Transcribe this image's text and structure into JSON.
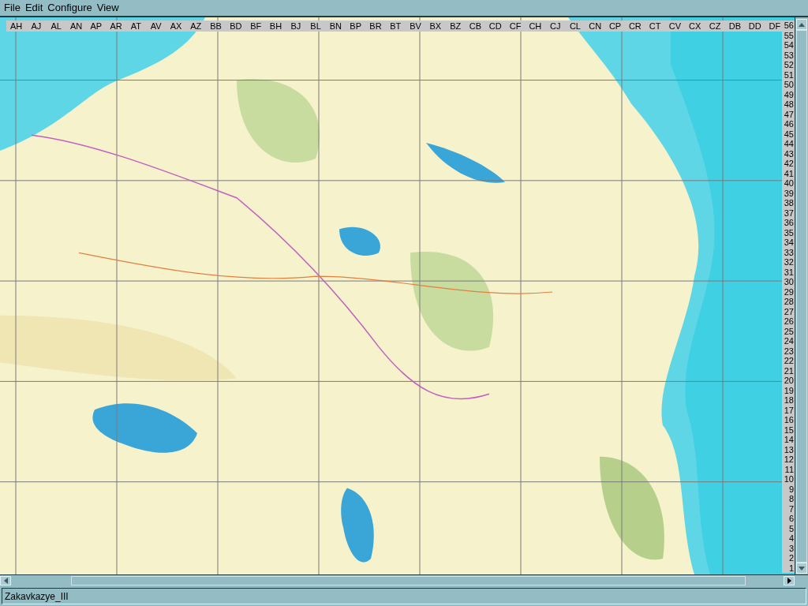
{
  "menu": [
    "File",
    "Edit",
    "Configure",
    "View"
  ],
  "grid_columns": [
    "AH",
    "AJ",
    "AL",
    "AN",
    "AP",
    "AR",
    "AT",
    "AV",
    "AX",
    "AZ",
    "BB",
    "BD",
    "BF",
    "BH",
    "BJ",
    "BL",
    "BN",
    "BP",
    "BR",
    "BT",
    "BV",
    "BX",
    "BZ",
    "CB",
    "CD",
    "CF",
    "CH",
    "CJ",
    "CL",
    "CN",
    "CP",
    "CR",
    "CT",
    "CV",
    "CX",
    "CZ",
    "DB",
    "DD",
    "DF"
  ],
  "grid_rows": [
    "56",
    "55",
    "54",
    "53",
    "52",
    "51",
    "50",
    "49",
    "48",
    "47",
    "46",
    "45",
    "44",
    "43",
    "42",
    "41",
    "40",
    "39",
    "38",
    "37",
    "36",
    "35",
    "34",
    "33",
    "32",
    "31",
    "30",
    "29",
    "28",
    "27",
    "26",
    "25",
    "24",
    "23",
    "22",
    "21",
    "20",
    "19",
    "18",
    "17",
    "16",
    "15",
    "14",
    "13",
    "12",
    "11",
    "10",
    "9",
    "8",
    "7",
    "6",
    "5",
    "4",
    "3",
    "2",
    "1"
  ],
  "status_bar": {
    "text": "Zakavkazye_III"
  }
}
